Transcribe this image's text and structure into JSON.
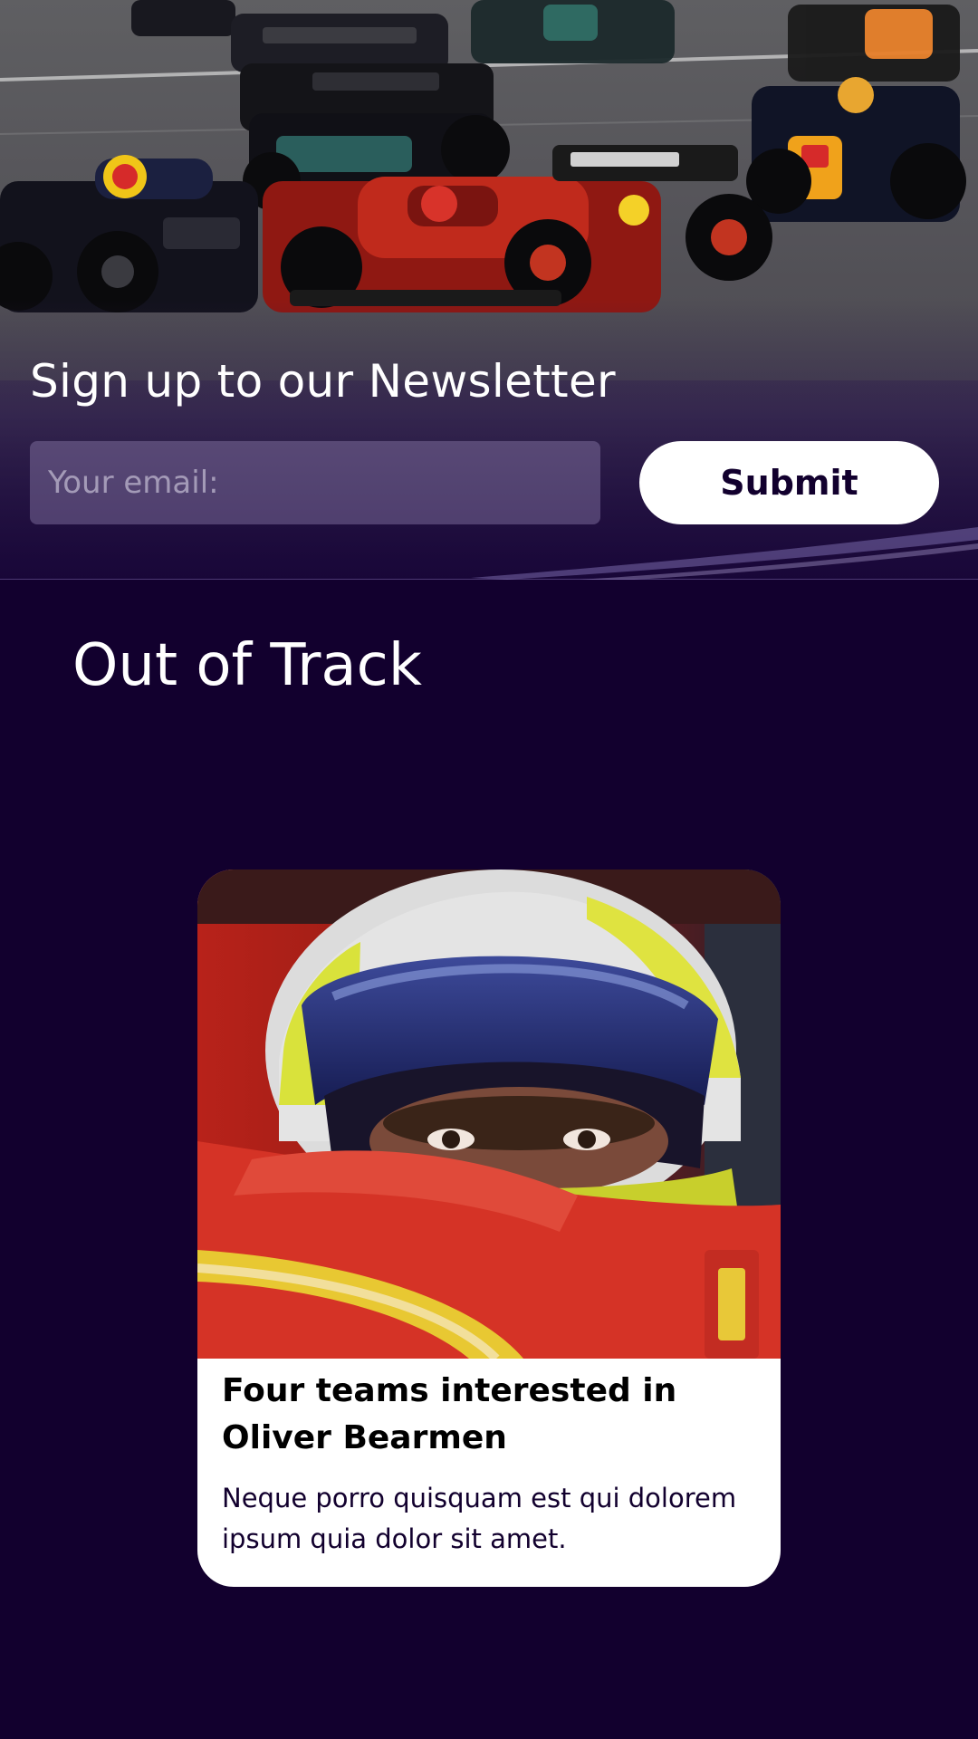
{
  "newsletter": {
    "title": "Sign up to our Newsletter",
    "email_placeholder": "Your email:",
    "submit_label": "Submit"
  },
  "section": {
    "title": "Out of Track"
  },
  "article": {
    "headline": "Four teams interested in Oliver Bearmen",
    "excerpt": "Neque porro quisquam est qui dolorem ipsum quia dolor sit amet."
  },
  "colors": {
    "background": "#12002e",
    "button_bg": "#ffffff",
    "button_text": "#12002e"
  }
}
